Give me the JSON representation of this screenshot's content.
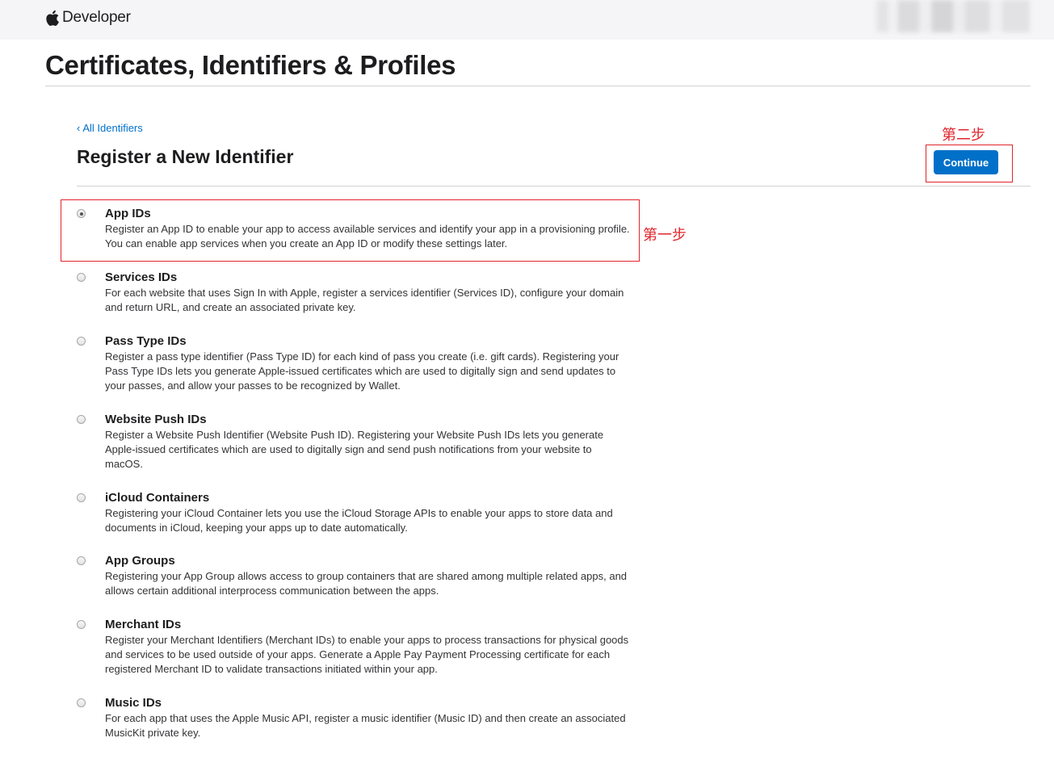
{
  "header": {
    "brand_label": "Developer"
  },
  "page_title": "Certificates, Identifiers & Profiles",
  "back_link": {
    "chevron": "‹",
    "label": "All Identifiers"
  },
  "section_title": "Register a New Identifier",
  "continue_label": "Continue",
  "annotations": {
    "step1": "第一步",
    "step2": "第二步",
    "color": "#e0242b"
  },
  "accent_color": "#0070c9",
  "options": [
    {
      "title": "App IDs",
      "selected": true,
      "description": "Register an App ID to enable your app to access available services and identify your app in a provisioning profile. You can enable app services when you create an App ID or modify these settings later."
    },
    {
      "title": "Services IDs",
      "selected": false,
      "description": "For each website that uses Sign In with Apple, register a services identifier (Services ID), configure your domain and return URL, and create an associated private key."
    },
    {
      "title": "Pass Type IDs",
      "selected": false,
      "description": "Register a pass type identifier (Pass Type ID) for each kind of pass you create (i.e. gift cards). Registering your Pass Type IDs lets you generate Apple-issued certificates which are used to digitally sign and send updates to your passes, and allow your passes to be recognized by Wallet."
    },
    {
      "title": "Website Push IDs",
      "selected": false,
      "description": "Register a Website Push Identifier (Website Push ID). Registering your Website Push IDs lets you generate Apple-issued certificates which are used to digitally sign and send push notifications from your website to macOS."
    },
    {
      "title": "iCloud Containers",
      "selected": false,
      "description": "Registering your iCloud Container lets you use the iCloud Storage APIs to enable your apps to store data and documents in iCloud, keeping your apps up to date automatically."
    },
    {
      "title": "App Groups",
      "selected": false,
      "description": "Registering your App Group allows access to group containers that are shared among multiple related apps, and allows certain additional interprocess communication between the apps."
    },
    {
      "title": "Merchant IDs",
      "selected": false,
      "description": "Register your Merchant Identifiers (Merchant IDs) to enable your apps to process transactions for physical goods and services to be used outside of your apps. Generate a Apple Pay Payment Processing certificate for each registered Merchant ID to validate transactions initiated within your app."
    },
    {
      "title": "Music IDs",
      "selected": false,
      "description": "For each app that uses the Apple Music API, register a music identifier (Music ID) and then create an associated MusicKit private key."
    }
  ]
}
